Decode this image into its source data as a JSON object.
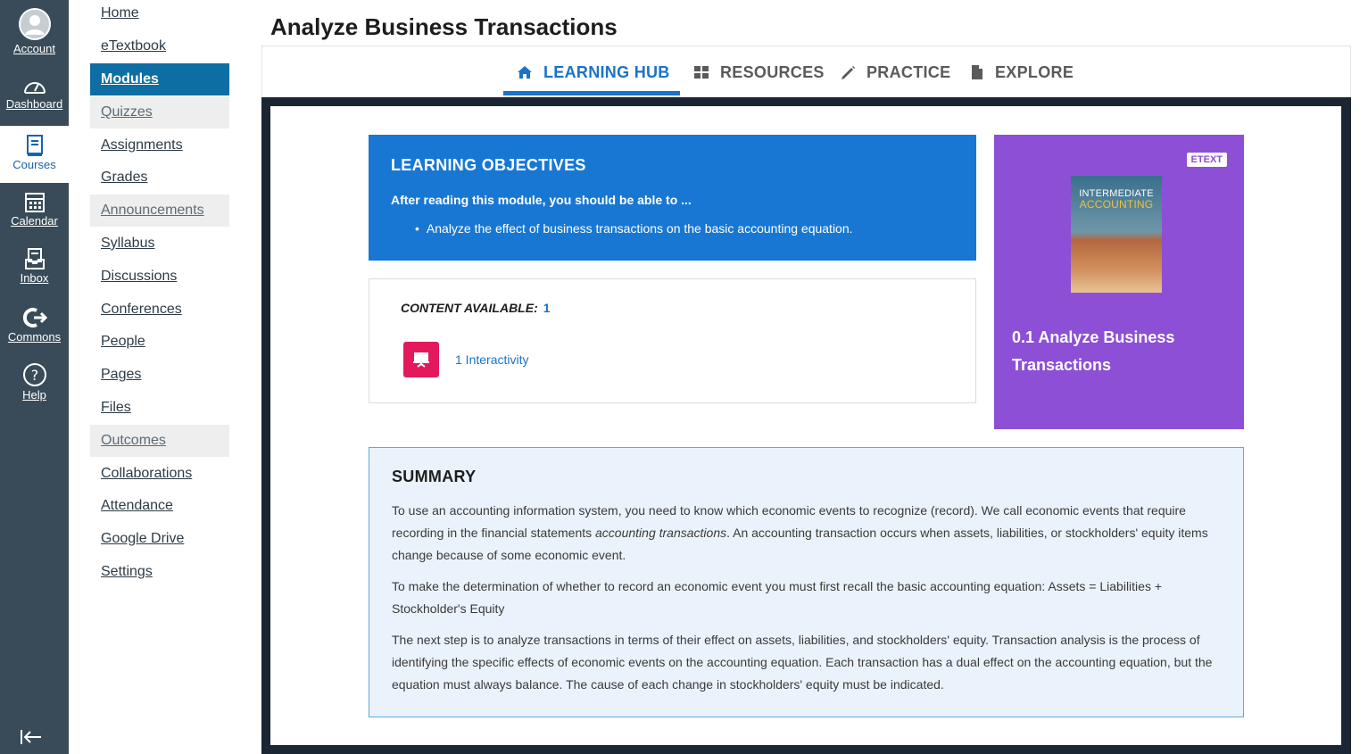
{
  "global_nav": {
    "account": "Account",
    "dashboard": "Dashboard",
    "courses": "Courses",
    "calendar": "Calendar",
    "inbox": "Inbox",
    "commons": "Commons",
    "help": "Help"
  },
  "course_nav": [
    "Home",
    "eTextbook",
    "Modules",
    "Quizzes",
    "Assignments",
    "Grades",
    "Announcements",
    "Syllabus",
    "Discussions",
    "Conferences",
    "People",
    "Pages",
    "Files",
    "Outcomes",
    "Collaborations",
    "Attendance",
    "Google Drive",
    "Settings"
  ],
  "page_title": "Analyze Business Transactions",
  "tabs": {
    "learning_hub": "LEARNING HUB",
    "resources": "RESOURCES",
    "practice": "PRACTICE",
    "explore": "EXPLORE"
  },
  "objectives": {
    "heading": "LEARNING OBJECTIVES",
    "intro": "After reading this module, you should be able to ...",
    "items": [
      "Analyze the effect of business transactions on the basic accounting equation."
    ]
  },
  "content": {
    "label": "CONTENT AVAILABLE:",
    "count": "1",
    "item_label": "1 Interactivity"
  },
  "etext": {
    "badge": "ETEXT",
    "book_title_line1": "INTERMEDIATE",
    "book_title_line2": "ACCOUNTING",
    "title": "0.1 Analyze Business Transactions"
  },
  "summary": {
    "heading": "SUMMARY",
    "p1_before": "To use an accounting information system, you need to know which economic events to recognize (record). We call economic events that require recording in the financial statements ",
    "p1_em": "accounting transactions",
    "p1_after": ". An accounting transaction occurs when assets, liabilities, or stockholders' equity items change because of some economic event.",
    "p2": "To make the determination of whether to record an economic event you must first recall the basic accounting equation: Assets = Liabilities + Stockholder's Equity",
    "p3": "The next step is to analyze transactions in terms of their effect on assets, liabilities, and stockholders' equity. Transaction analysis is the process of identifying the specific effects of economic events on the accounting equation. Each transaction has a dual effect on the accounting equation, but the equation must always balance. The cause of each change in stockholders' equity must be indicated."
  },
  "colors": {
    "global_nav_bg": "#394b58",
    "modules_active": "#0d6ea3",
    "tab_active": "#1a73c9",
    "objectives_bg": "#1877d2",
    "etext_bg": "#8c4fd6",
    "interactivity_icon": "#e3195b",
    "summary_bg": "#eaf3fb"
  }
}
